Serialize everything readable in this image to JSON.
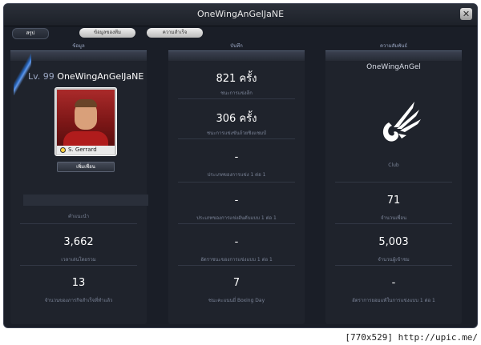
{
  "window": {
    "title": "OneWingAnGelJaNE",
    "close_label": "✕"
  },
  "tabs": [
    {
      "label": "สรุป",
      "active": true
    },
    {
      "label": "ข้อมูลของทีม",
      "active": false
    },
    {
      "label": "ความสำเร็จ",
      "active": false
    }
  ],
  "columns": {
    "info": {
      "header": "ข้อมูล"
    },
    "records": {
      "header": "บันทึก"
    },
    "relations": {
      "header": "ความสัมพันธ์"
    }
  },
  "profile": {
    "level_label": "Lv. 99",
    "name": "OneWingAnGelJaNE",
    "player_name": "S. Gerrard",
    "add_friend_label": "เพิ่มเพื่อน"
  },
  "info_stats": [
    {
      "value": "",
      "label": "คำแนะนำ"
    },
    {
      "value": "3,662",
      "label": "เวลาเล่นโดยรวม"
    },
    {
      "value": "13",
      "label": "จำนวนของภารกิจสำเร็จที่ทำแล้ว"
    }
  ],
  "records_stats": [
    {
      "value": "821 ครั้ง",
      "label": "ชนะการแข่งลีก"
    },
    {
      "value": "306 ครั้ง",
      "label": "ชนะการแข่งขันถ้วยชิงแชมป์"
    },
    {
      "value": "-",
      "label": "ประเภทของการแข่ง 1 ต่อ 1"
    },
    {
      "value": "-",
      "label": "ประเภทของการแข่งอันดับแบบ 1 ต่อ 1"
    },
    {
      "value": "-",
      "label": "อัตราชนะของการแข่งแบบ 1 ต่อ 1"
    },
    {
      "value": "7",
      "label": "ชนะคะแนนยี่ Boxing Day"
    }
  ],
  "relations": {
    "club_name": "OneWingAnGel",
    "club_label": "Club",
    "stats": [
      {
        "value": "71",
        "label": "จำนวนเพื่อน"
      },
      {
        "value": "5,003",
        "label": "จำนวนผู้เข้าชม"
      },
      {
        "value": "-",
        "label": "อัตราการยอมแพ้ในการแข่งแบบ 1 ต่อ 1"
      }
    ]
  },
  "footer": {
    "text": "[770x529] http://upic.me/"
  },
  "colors": {
    "background": "#1a1e27",
    "panel": "#1f232c",
    "accent": "#2a6fd0",
    "label": "#7a8397"
  }
}
